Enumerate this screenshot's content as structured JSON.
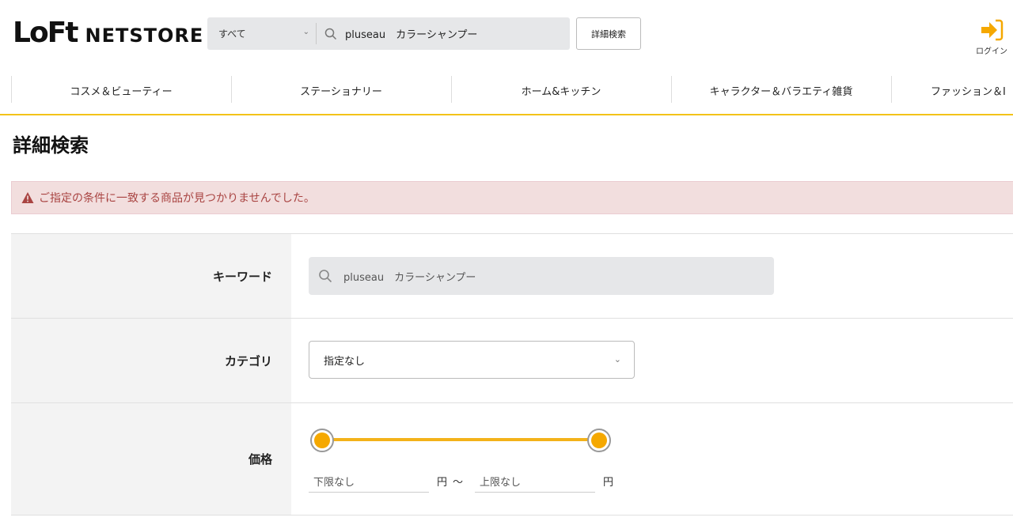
{
  "header": {
    "logo_mark": "LoFt",
    "logo_text": "NETSTORE",
    "search_category": "すべて",
    "search_value": "pluseau　カラーシャンプー",
    "detail_search_label": "詳細検索",
    "login_label": "ログイン"
  },
  "nav": {
    "items": [
      {
        "label": "コスメ＆ビューティー"
      },
      {
        "label": "ステーショナリー"
      },
      {
        "label": "ホーム&キッチン"
      },
      {
        "label": "キャラクター＆バラエティ雑貨"
      },
      {
        "label": "ファッション＆I"
      }
    ]
  },
  "page": {
    "title": "詳細検索",
    "alert": "ご指定の条件に一致する商品が見つかりませんでした。"
  },
  "form": {
    "keyword_label": "キーワード",
    "keyword_value": "pluseau　カラーシャンプー",
    "category_label": "カテゴリ",
    "category_value": "指定なし",
    "price_label": "価格",
    "price_min_placeholder": "下限なし",
    "price_max_placeholder": "上限なし",
    "price_unit": "円",
    "price_tilde": "～",
    "price_slider": {
      "min_fraction": 0,
      "max_fraction": 1
    }
  },
  "colors": {
    "accent_yellow": "#f3c318",
    "slider_orange": "#f5a800",
    "alert_bg": "#f2dede",
    "alert_text": "#a94442"
  }
}
